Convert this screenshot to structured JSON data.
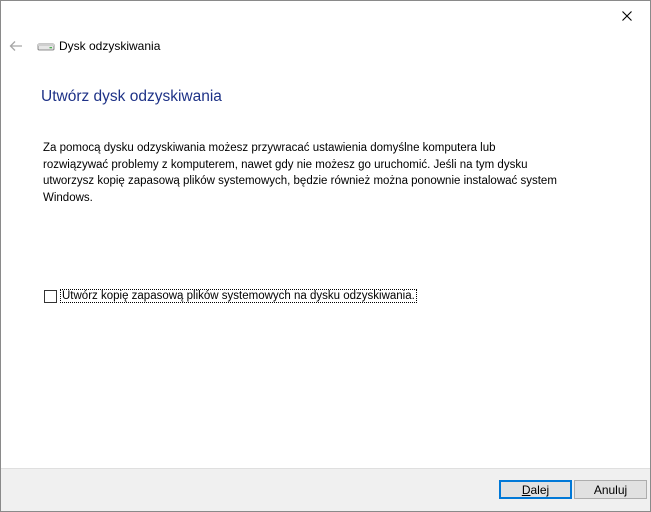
{
  "nav": {
    "title": "Dysk odzyskiwania"
  },
  "main": {
    "heading": "Utwórz dysk odzyskiwania",
    "description": "Za pomocą dysku odzyskiwania możesz przywracać ustawienia domyślne komputera lub rozwiązywać problemy z komputerem, nawet gdy nie możesz go uruchomić. Jeśli na tym dysku utworzysz kopię zapasową plików systemowych, będzie również można ponownie instalować system Windows.",
    "checkbox_label": "Utwórz kopię zapasową plików systemowych na dysku odzyskiwania.",
    "checkbox_checked": false
  },
  "footer": {
    "next_accel": "D",
    "next_rest": "alej",
    "cancel_label": "Anuluj"
  },
  "colors": {
    "heading": "#1e3287",
    "primary_border": "#0078d7",
    "footer_bg": "#f0f0f0"
  },
  "icons": {
    "close": "close-icon",
    "back": "back-arrow-icon",
    "drive": "drive-icon"
  }
}
